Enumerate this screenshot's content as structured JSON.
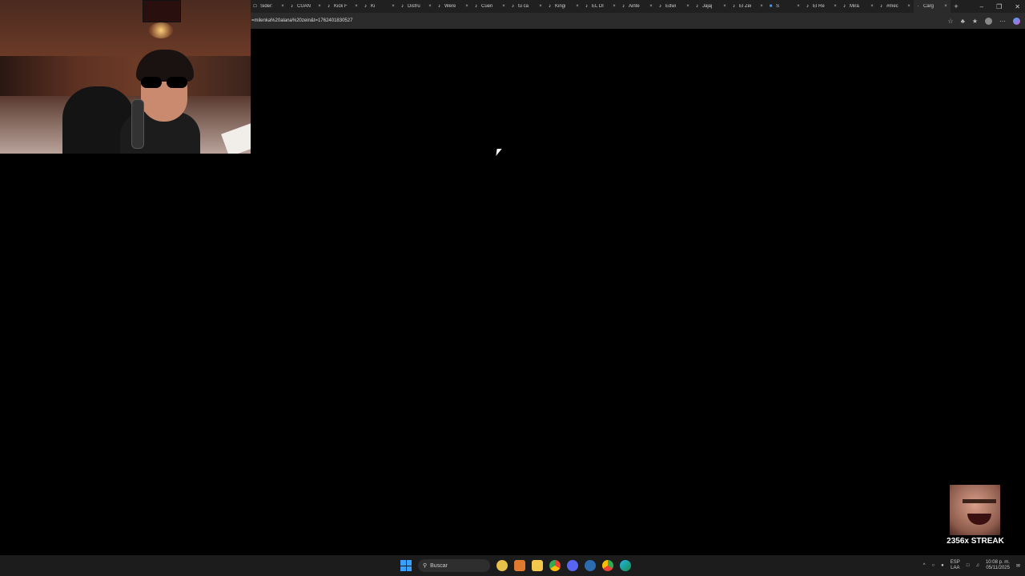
{
  "browser": {
    "tabs": [
      {
        "label": "Sider:",
        "icon": "doc-icon"
      },
      {
        "label": "CUAN",
        "icon": "tiktok-icon"
      },
      {
        "label": "Kick F",
        "icon": "tiktok-icon"
      },
      {
        "label": "Ki",
        "icon": "tiktok-icon"
      },
      {
        "label": "Disfru",
        "icon": "tiktok-icon"
      },
      {
        "label": "Were",
        "icon": "tiktok-icon"
      },
      {
        "label": "Cuen",
        "icon": "tiktok-icon"
      },
      {
        "label": "tu ca",
        "icon": "tiktok-icon"
      },
      {
        "label": "Kingi",
        "icon": "tiktok-icon"
      },
      {
        "label": "EL DI",
        "icon": "tiktok-icon"
      },
      {
        "label": "Ainte",
        "icon": "tiktok-icon"
      },
      {
        "label": "Edwi",
        "icon": "tiktok-icon"
      },
      {
        "label": "Jajaj",
        "icon": "tiktok-icon"
      },
      {
        "label": "El Zei",
        "icon": "tiktok-icon"
      },
      {
        "label": "S",
        "icon": "blue-app-icon"
      },
      {
        "label": "El Re",
        "icon": "tiktok-icon"
      },
      {
        "label": "Mira",
        "icon": "tiktok-icon"
      },
      {
        "label": "#mec",
        "icon": "tiktok-icon"
      },
      {
        "label": "Carg",
        "icon": "loading-icon",
        "active": true
      }
    ],
    "new_tab": "+",
    "url": "=milenka%20alana%20zein&t=1762401830527"
  },
  "overlay": {
    "streak_label": "2356x STREAK"
  },
  "taskbar": {
    "search_placeholder": "Buscar",
    "lang_line1": "ESP",
    "lang_line2": "LAA",
    "time": "10:08 p. m.",
    "date": "05/11/2025"
  }
}
